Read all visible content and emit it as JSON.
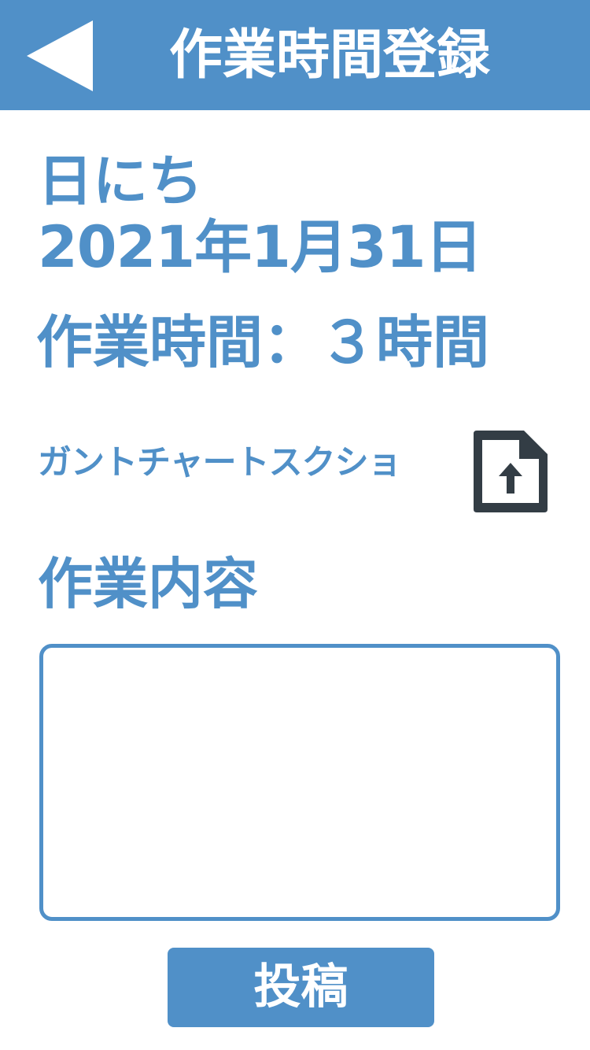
{
  "colors": {
    "primary": "#5090c8",
    "background": "#ffffff",
    "icon_dark": "#333d45"
  },
  "header": {
    "back_icon": "back-arrow-icon",
    "title": "作業時間登録"
  },
  "date": {
    "label": "日にち",
    "value": "2021年1月31日"
  },
  "work_time": {
    "text": "作業時間：３時間"
  },
  "gantt": {
    "label": "ガントチャートスクショ",
    "upload_icon": "file-upload-icon"
  },
  "content": {
    "label": "作業内容",
    "value": ""
  },
  "post": {
    "label": "投稿"
  }
}
